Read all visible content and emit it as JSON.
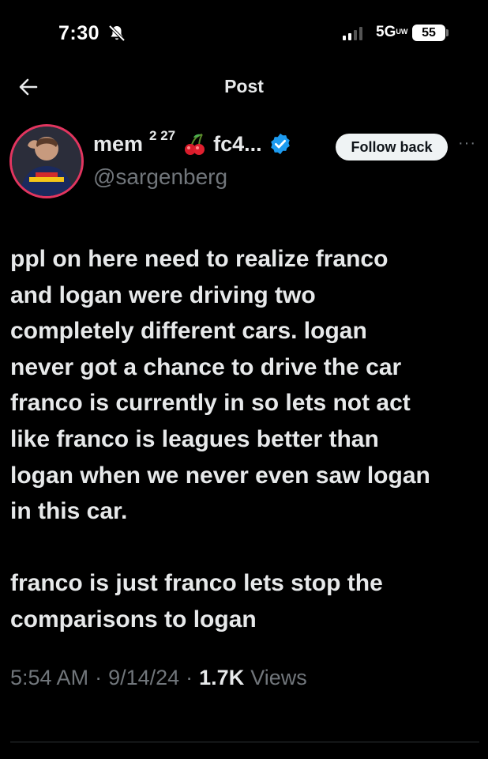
{
  "status_bar": {
    "time": "7:30",
    "network": "5G",
    "network_superscript": "UW",
    "battery": "55",
    "icons": [
      "bell-slash-icon",
      "signal-icon",
      "battery-icon"
    ]
  },
  "nav": {
    "title": "Post",
    "back_icon": "arrow-left-icon"
  },
  "author": {
    "display_name": "mem",
    "name_superscript": "2 27",
    "name_suffix": "fc4...",
    "name_icons": [
      "cherry-icon",
      "verified-badge-icon"
    ],
    "handle": "@sargenberg",
    "follow_label": "Follow back",
    "more_label": "···"
  },
  "post": {
    "lines": [
      "ppl on here need to realize franco",
      "and logan were driving two",
      "completely different cars. logan",
      "never got a chance to drive the car",
      "franco is currently in so lets not act",
      "like franco is leagues better than",
      "logan when we never even saw logan",
      "in this car."
    ],
    "lines_2": [
      "franco is just franco lets stop the",
      "comparisons to logan"
    ]
  },
  "meta": {
    "time": "5:54 AM",
    "sep1": "·",
    "date": "9/14/24",
    "sep2": "·",
    "view_count": "1.7K",
    "views_label": "Views"
  },
  "colors": {
    "background": "#000000",
    "text": "#e7e9ea",
    "secondary": "#71767b",
    "verified": "#1d9bf0",
    "avatar_ring": "#e2355f"
  }
}
